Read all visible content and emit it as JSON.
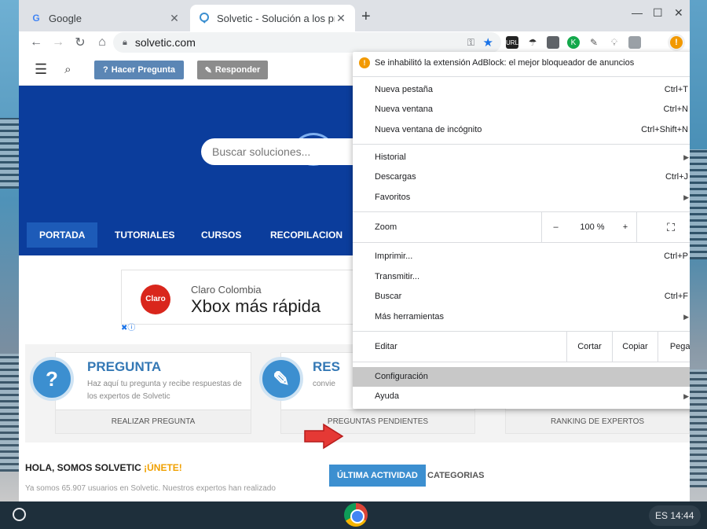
{
  "browser": {
    "tabs": [
      {
        "title": "Google",
        "favicon": "G"
      },
      {
        "title": "Solvetic - Solución a los problem"
      }
    ],
    "url": "solvetic.com",
    "new_tab_symbol": "+",
    "close_symbol": "✕",
    "controls": {
      "minimize": "—",
      "maximize": "☐",
      "close": "✕"
    },
    "extensions": [
      {
        "name": "url-icon",
        "label": "URL",
        "color": "#222222"
      },
      {
        "name": "k-icon",
        "label": "K",
        "color": "#13a84b"
      }
    ]
  },
  "site": {
    "ask_button": "Hacer Pregunta",
    "answer_button": "Responder",
    "search_placeholder": "Buscar soluciones...",
    "nav": [
      "PORTADA",
      "TUTORIALES",
      "CURSOS",
      "RECOPILACION"
    ],
    "ad": {
      "sub": "Claro Colombia",
      "headline": "Xbox más rápida",
      "logo": "Claro"
    },
    "cards": [
      {
        "title": "PREGUNTA",
        "desc": "Haz aquí tu pregunta y recibe respuestas de los expertos de Solvetic",
        "footer": "REALIZAR PREGUNTA",
        "icon": "?"
      },
      {
        "title": "RES",
        "desc": "convie",
        "footer": "PREGUNTAS PENDIENTES",
        "icon": "✎"
      },
      {
        "footer": "RANKING DE EXPERTOS"
      }
    ],
    "hello": "HOLA, SOMOS SOLVETIC ",
    "join": "¡ÚNETE!",
    "users_text": "Ya somos 65.907 usuarios en Solvetic. Nuestros expertos han realizado",
    "tabs": [
      "ÚLTIMA ACTIVIDAD",
      "CATEGORIAS"
    ]
  },
  "menu": {
    "notice": "Se inhabilitó la extensión AdBlock: el mejor bloqueador de anuncios",
    "group1": [
      {
        "label": "Nueva pestaña",
        "shortcut": "Ctrl+T"
      },
      {
        "label": "Nueva ventana",
        "shortcut": "Ctrl+N"
      },
      {
        "label": "Nueva ventana de incógnito",
        "shortcut": "Ctrl+Shift+N"
      }
    ],
    "group2": [
      {
        "label": "Historial",
        "arrow": "▶"
      },
      {
        "label": "Descargas",
        "shortcut": "Ctrl+J"
      },
      {
        "label": "Favoritos",
        "arrow": "▶"
      }
    ],
    "zoom": {
      "label": "Zoom",
      "minus": "–",
      "value": "100 %",
      "plus": "+",
      "fullscreen": "⛶"
    },
    "group3": [
      {
        "label": "Imprimir...",
        "shortcut": "Ctrl+P"
      },
      {
        "label": "Transmitir..."
      },
      {
        "label": "Buscar",
        "shortcut": "Ctrl+F"
      },
      {
        "label": "Más herramientas",
        "arrow": "▶"
      }
    ],
    "edit": {
      "label": "Editar",
      "cut": "Cortar",
      "copy": "Copiar",
      "paste": "Pegar"
    },
    "settings": "Configuración",
    "help": "Ayuda",
    "help_arrow": "▶"
  },
  "shelf": {
    "status": "ES 14:44"
  }
}
